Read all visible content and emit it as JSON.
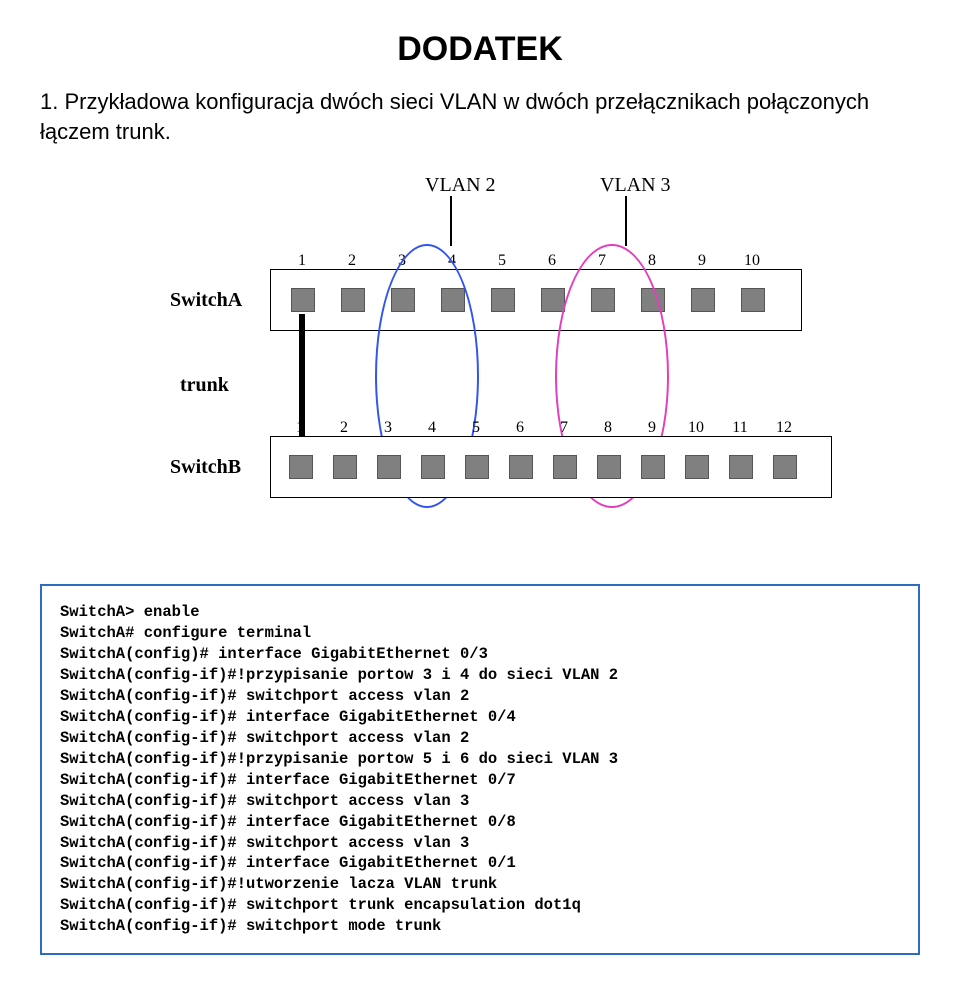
{
  "title": "DODATEK",
  "intro": "1. Przykładowa konfiguracja dwóch sieci VLAN w dwóch przełącznikach połączonych łączem trunk.",
  "diagram": {
    "vlan2": "VLAN 2",
    "vlan3": "VLAN 3",
    "switchA": "SwitchA",
    "switchB": "SwitchB",
    "trunk": "trunk",
    "portsA": [
      "1",
      "2",
      "3",
      "4",
      "5",
      "6",
      "7",
      "8",
      "9",
      "10"
    ],
    "portsB": [
      "1",
      "2",
      "3",
      "4",
      "5",
      "6",
      "7",
      "8",
      "9",
      "10",
      "11",
      "12"
    ]
  },
  "code": "SwitchA> enable\nSwitchA# configure terminal\nSwitchA(config)# interface GigabitEthernet 0/3\nSwitchA(config-if)#!przypisanie portow 3 i 4 do sieci VLAN 2\nSwitchA(config-if)# switchport access vlan 2\nSwitchA(config-if)# interface GigabitEthernet 0/4\nSwitchA(config-if)# switchport access vlan 2\nSwitchA(config-if)#!przypisanie portow 5 i 6 do sieci VLAN 3\nSwitchA(config-if)# interface GigabitEthernet 0/7\nSwitchA(config-if)# switchport access vlan 3\nSwitchA(config-if)# interface GigabitEthernet 0/8\nSwitchA(config-if)# switchport access vlan 3\nSwitchA(config-if)# interface GigabitEthernet 0/1\nSwitchA(config-if)#!utworzenie lacza VLAN trunk\nSwitchA(config-if)# switchport trunk encapsulation dot1q\nSwitchA(config-if)# switchport mode trunk"
}
